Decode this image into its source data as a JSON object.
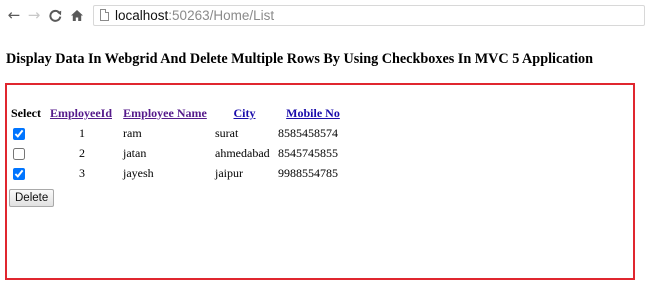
{
  "browser": {
    "back_glyph": "←",
    "forward_glyph": "→",
    "reload_glyph": "C",
    "home_glyph": "⌂",
    "url_host": "localhost",
    "url_path": ":50263/Home/List"
  },
  "page": {
    "heading": "Display Data In Webgrid And Delete Multiple Rows By Using Checkboxes In MVC 5 Application"
  },
  "grid": {
    "headers": {
      "select": "Select",
      "employee_id": "EmployeeId",
      "employee_name": "Employee Name",
      "city": "City",
      "mobile": "Mobile No"
    },
    "rows": [
      {
        "checked": true,
        "id": "1",
        "name": "ram",
        "city": "surat",
        "mobile": "8585458574"
      },
      {
        "checked": false,
        "id": "2",
        "name": "jatan",
        "city": "ahmedabad",
        "mobile": "8545745855"
      },
      {
        "checked": true,
        "id": "3",
        "name": "jayesh",
        "city": "jaipur",
        "mobile": "9988554785"
      }
    ],
    "delete_label": "Delete"
  },
  "colors": {
    "frame_border": "#e0262f",
    "link": "#1a0dab",
    "visited_link": "#551a8b"
  }
}
